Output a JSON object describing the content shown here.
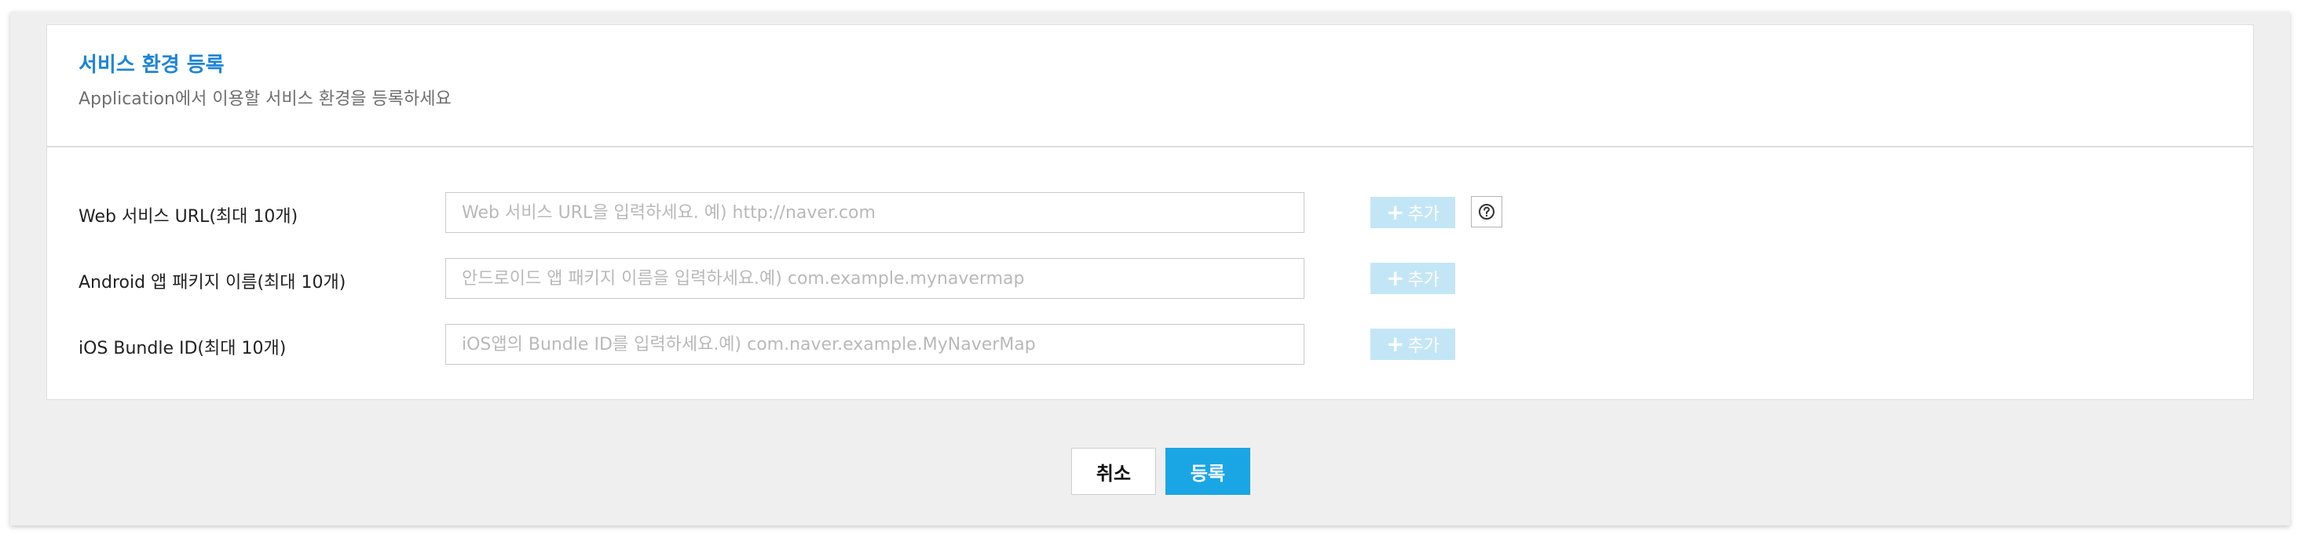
{
  "section": {
    "title": "서비스 환경 등록",
    "subtitle": "Application에서 이용할 서비스 환경을 등록하세요"
  },
  "rows": [
    {
      "label": "Web 서비스 URL(최대 10개)",
      "placeholder": "Web 서비스 URL을 입력하세요. 예) http://naver.com",
      "value": "",
      "add_label": "추가"
    },
    {
      "label": "Android 앱 패키지 이름(최대 10개)",
      "placeholder": "안드로이드 앱 패키지 이름을 입력하세요.예) com.example.mynavermap",
      "value": "",
      "add_label": "추가"
    },
    {
      "label": "iOS Bundle ID(최대 10개)",
      "placeholder": "iOS앱의 Bundle ID를 입력하세요.예) com.naver.example.MyNaverMap",
      "value": "",
      "add_label": "추가"
    }
  ],
  "icons": {
    "plus": "plus-icon",
    "help": "question-circle-icon"
  },
  "actions": {
    "cancel_label": "취소",
    "submit_label": "등록"
  },
  "colors": {
    "title": "#1f86d6",
    "primary_button": "#1aa6e4",
    "disabled_add_button": "#c3e6f6",
    "panel_background": "#efefef"
  }
}
